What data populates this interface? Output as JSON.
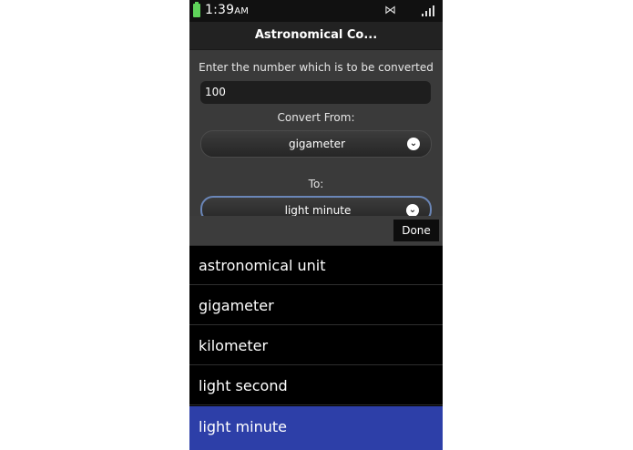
{
  "status": {
    "time": "1:39",
    "ampm": "AM"
  },
  "app": {
    "title": "Astronomical Co..."
  },
  "form": {
    "prompt": "Enter the number which is to be converted",
    "number_value": "100",
    "from_label": "Convert From:",
    "from_value": "gigameter",
    "to_label": "To:",
    "to_value": "light minute"
  },
  "toolbar": {
    "done_label": "Done"
  },
  "picker": {
    "options": [
      "astronomical unit",
      "gigameter",
      "kilometer",
      "light second",
      "light minute"
    ],
    "selected": "light minute"
  },
  "colors": {
    "selected": "#2d3fa8",
    "battery": "#5fd35a"
  },
  "icons": [
    "battery-icon",
    "bluetooth-icon",
    "signal-icon",
    "chevron-down-icon"
  ]
}
